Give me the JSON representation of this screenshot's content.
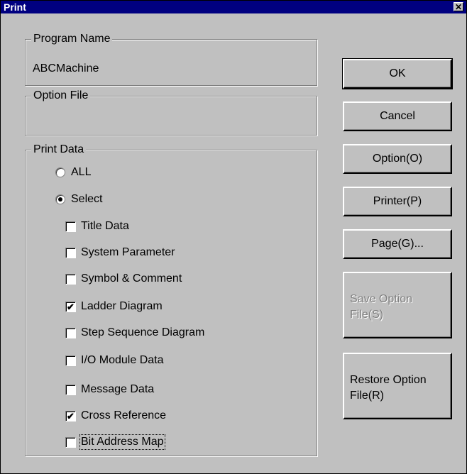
{
  "dialog": {
    "title": "Print",
    "close_glyph": "✕"
  },
  "program_name": {
    "legend": "Program Name",
    "value": "ABCMachine"
  },
  "option_file": {
    "legend": "Option File",
    "value": ""
  },
  "print_data": {
    "legend": "Print Data",
    "radios": [
      {
        "label": "ALL",
        "selected": false
      },
      {
        "label": "Select",
        "selected": true
      }
    ],
    "items": [
      {
        "label": "Title Data",
        "checked": false
      },
      {
        "label": "System Parameter",
        "checked": false
      },
      {
        "label": "Symbol & Comment",
        "checked": false
      },
      {
        "label": "Ladder Diagram",
        "checked": true
      },
      {
        "label": "Step Sequence Diagram",
        "checked": false
      },
      {
        "label": "I/O Module Data",
        "checked": false
      },
      {
        "label": "Message Data",
        "checked": false
      },
      {
        "label": "Cross Reference",
        "checked": true
      },
      {
        "label": "Bit Address Map",
        "checked": false
      }
    ]
  },
  "buttons": {
    "ok": "OK",
    "cancel": "Cancel",
    "option": "Option(O)",
    "printer": "Printer(P)",
    "page": "Page(G)...",
    "save_option_line1": "Save Option",
    "save_option_line2": "File(S)",
    "restore_option_line1": "Restore Option",
    "restore_option_line2": "File(R)"
  },
  "check_glyph": "✔"
}
